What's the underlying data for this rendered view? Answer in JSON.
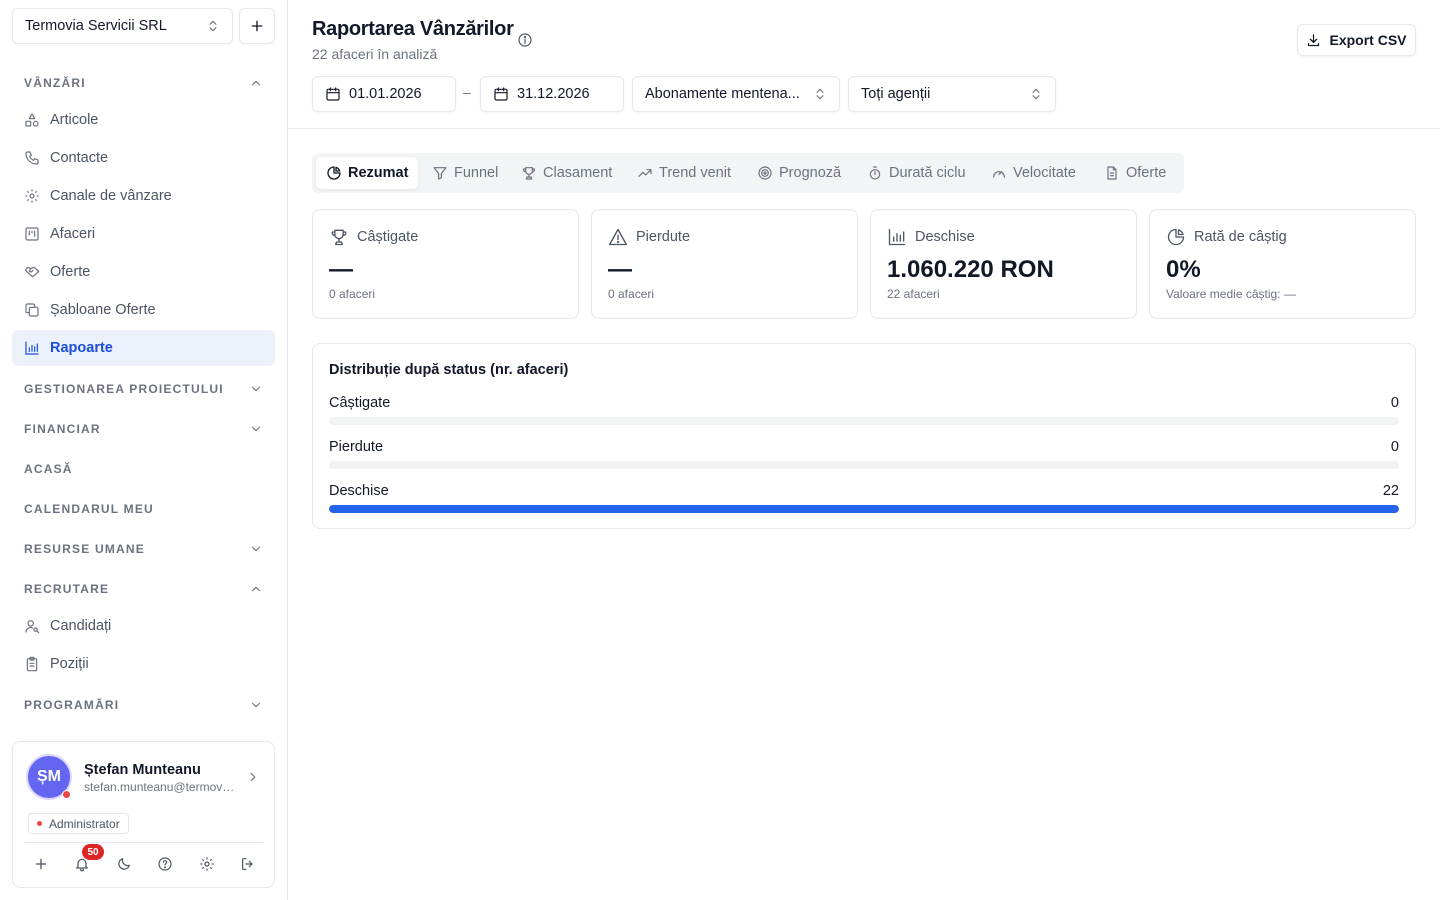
{
  "sidebar": {
    "org_name": "Termovia Servicii SRL",
    "sections": {
      "vanzari": "VÂNZĂRI",
      "proiect": "GESTIONAREA PROIECTULUI",
      "financiar": "FINANCIAR",
      "acasa": "ACASĂ",
      "calendar": "CALENDARUL MEU",
      "resurse": "RESURSE UMANE",
      "recrutare": "RECRUTARE",
      "programari": "PROGRAMĂRI"
    },
    "items": {
      "articole": "Articole",
      "contacte": "Contacte",
      "canale": "Canale de vânzare",
      "afaceri": "Afaceri",
      "oferte": "Oferte",
      "sabloane": "Șabloane Oferte",
      "rapoarte": "Rapoarte",
      "candidati": "Candidați",
      "pozitii": "Poziții"
    },
    "user": {
      "initials": "ȘM",
      "name": "Ștefan Munteanu",
      "email": "stefan.munteanu@termovia.ro",
      "role": "Administrator",
      "notifications": "50"
    }
  },
  "header": {
    "title": "Raportarea Vânzărilor",
    "subtitle": "22 afaceri în analiză",
    "export_label": "Export CSV",
    "filters": {
      "date_from": "01.01.2026",
      "date_sep": "–",
      "date_to": "31.12.2026",
      "channel": "Abonamente mentena...",
      "agents": "Toți agenții"
    }
  },
  "tabs": {
    "rezumat": "Rezumat",
    "funnel": "Funnel",
    "clasament": "Clasament",
    "trend": "Trend venit",
    "prognoza": "Prognoză",
    "durata": "Durată ciclu",
    "velocitate": "Velocitate",
    "oferte": "Oferte"
  },
  "stats": {
    "castigate": {
      "label": "Câștigate",
      "value": "—",
      "foot": "0 afaceri"
    },
    "pierdute": {
      "label": "Pierdute",
      "value": "—",
      "foot": "0 afaceri"
    },
    "deschise": {
      "label": "Deschise",
      "value": "1.060.220 RON",
      "foot": "22 afaceri"
    },
    "rata": {
      "label": "Rată de câștig",
      "value": "0%",
      "foot": "Valoare medie câștig: —"
    }
  },
  "distribution": {
    "title": "Distribuție după status (nr. afaceri)",
    "rows": [
      {
        "label": "Câștigate",
        "value": "0",
        "fraction": 0
      },
      {
        "label": "Pierdute",
        "value": "0",
        "fraction": 0
      },
      {
        "label": "Deschise",
        "value": "22",
        "fraction": 1
      }
    ]
  },
  "colors": {
    "accent": "#1d4ed8",
    "bar_fill": "#2563eb",
    "active_nav_bg": "#eaf1fb",
    "avatar": "#6366f1",
    "badge": "#dc2626"
  }
}
